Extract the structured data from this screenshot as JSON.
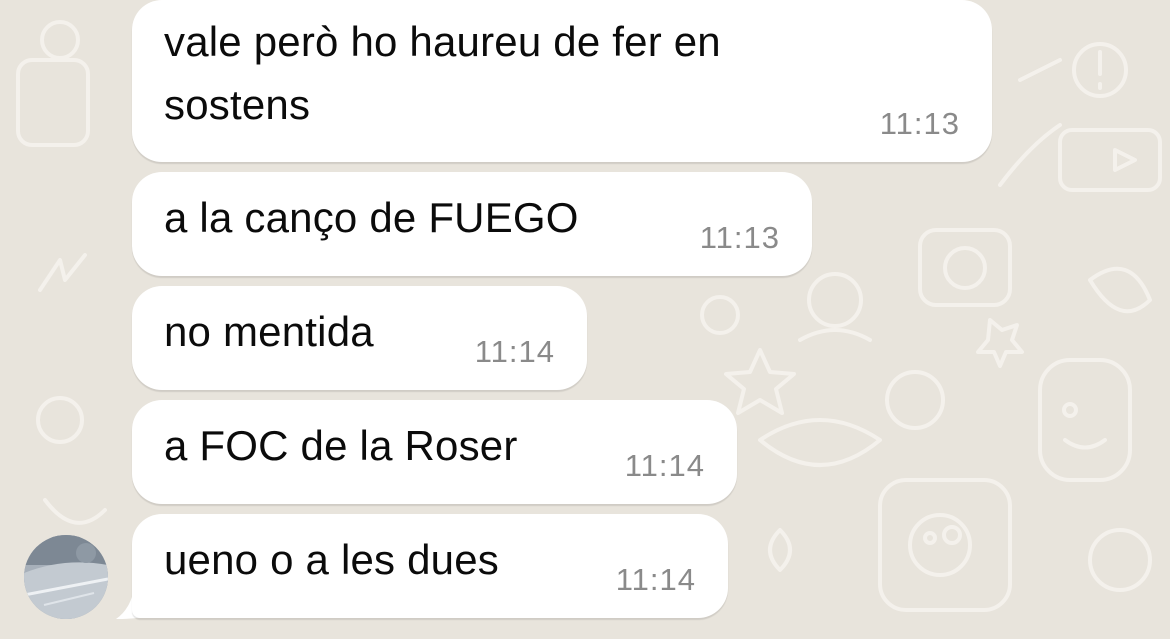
{
  "chat": {
    "messages": [
      {
        "text": "vale però ho haureu de fer en sostens",
        "time": "11:13"
      },
      {
        "text": "a la canço de FUEGO",
        "time": "11:13"
      },
      {
        "text": "no mentida",
        "time": "11:14"
      },
      {
        "text": "a FOC de la Roser",
        "time": "11:14"
      },
      {
        "text": "ueno o a les dues",
        "time": "11:14"
      }
    ]
  },
  "colors": {
    "background": "#e8e4dc",
    "bubble": "#ffffff",
    "text": "#0b0b0b",
    "timestamp": "#8a8a8a"
  }
}
